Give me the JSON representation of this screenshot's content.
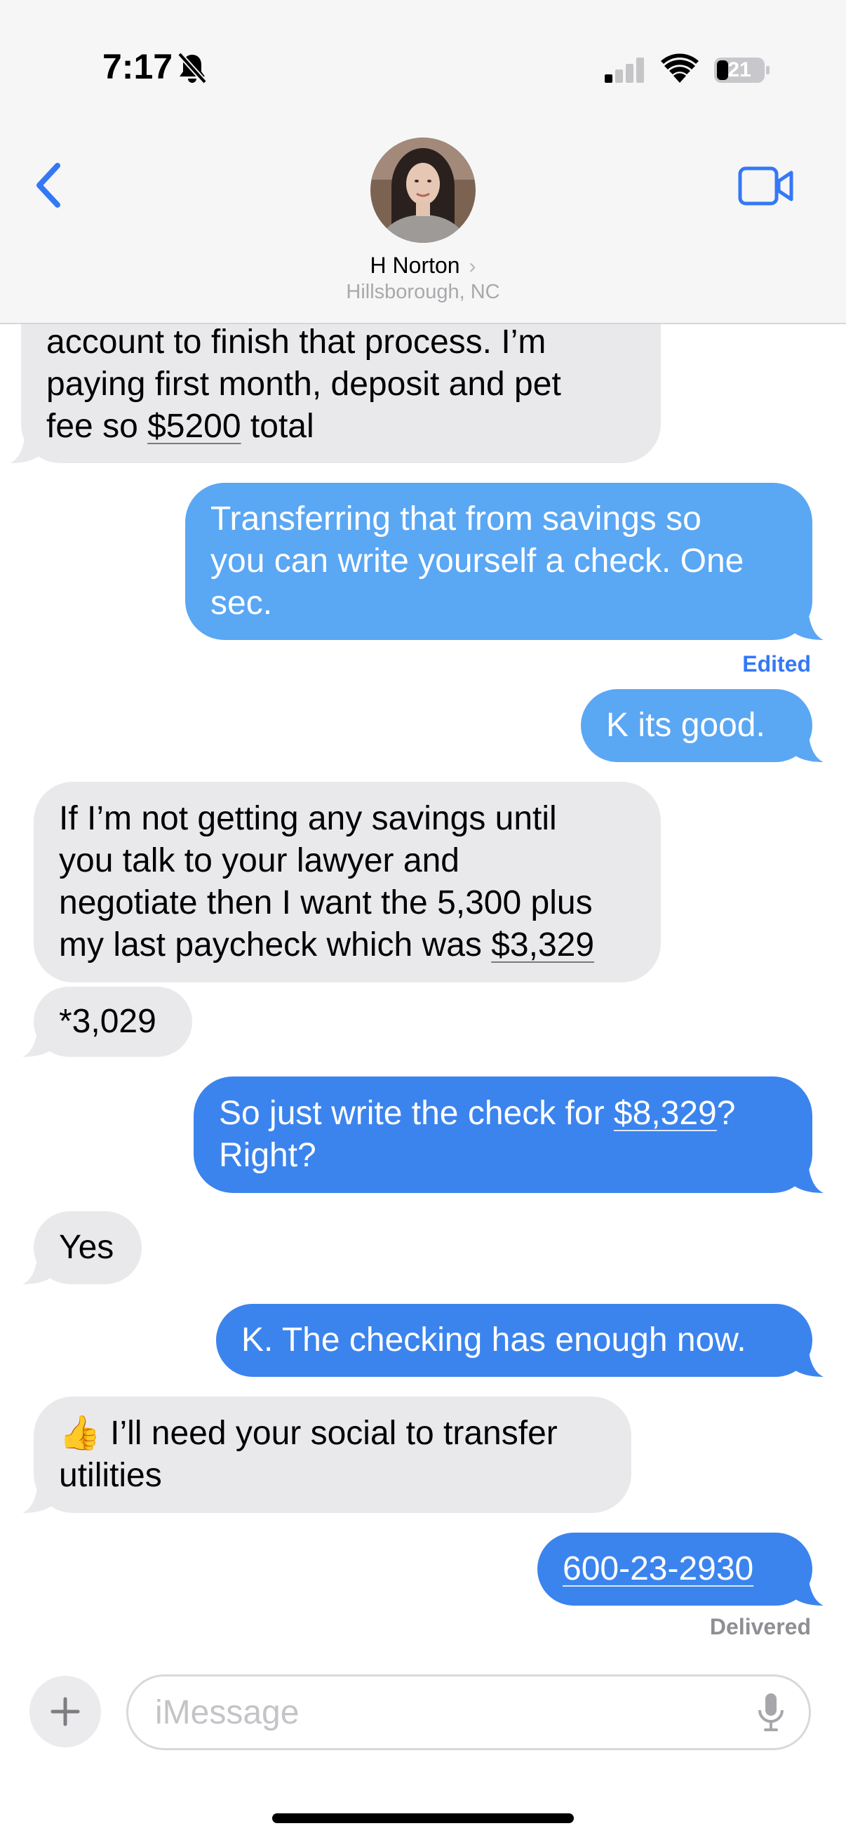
{
  "status_bar": {
    "time": "7:17",
    "battery": "21"
  },
  "header": {
    "contact_name": "H Norton",
    "location": "Hillsborough, NC"
  },
  "messages": [
    {
      "dir": "in",
      "lines": [
        "account to finish that process. I’m",
        "paying first month, deposit and pet",
        "fee so $5200 total"
      ],
      "link": "$5200"
    },
    {
      "dir": "out",
      "lines": [
        "Transferring that from savings so",
        "you can write yourself a check. One",
        "sec."
      ],
      "status": "Edited"
    },
    {
      "dir": "out",
      "lines": [
        "K its good."
      ]
    },
    {
      "dir": "in",
      "lines": [
        "If I’m not getting any savings until",
        "you talk to your lawyer and",
        "negotiate then I want the 5,300 plus",
        "my last paycheck which was $3,329"
      ],
      "link": "$3,329"
    },
    {
      "dir": "in",
      "lines": [
        "*3,029"
      ]
    },
    {
      "dir": "out",
      "lines": [
        "So just write the check for $8,329?",
        "Right?"
      ],
      "link": "$8,329"
    },
    {
      "dir": "in",
      "lines": [
        "Yes"
      ]
    },
    {
      "dir": "out",
      "lines": [
        "K. The checking has enough now."
      ]
    },
    {
      "dir": "in",
      "lines": [
        "👍 I’ll need your social to transfer",
        "utilities"
      ]
    },
    {
      "dir": "out",
      "lines": [
        "600-23-2930"
      ],
      "link": "600-23-2930",
      "status": "Delivered"
    }
  ],
  "input": {
    "placeholder": "iMessage"
  },
  "colors": {
    "accent": "#3478f6",
    "incoming": "#e9e9eb",
    "outgoing_light": "#5aa7f4",
    "outgoing": "#3b84ee"
  },
  "icons": [
    "bell-slash-icon",
    "cellular-signal-icon",
    "wifi-icon",
    "battery-icon",
    "back-chevron-icon",
    "video-camera-icon",
    "plus-icon",
    "microphone-icon"
  ]
}
